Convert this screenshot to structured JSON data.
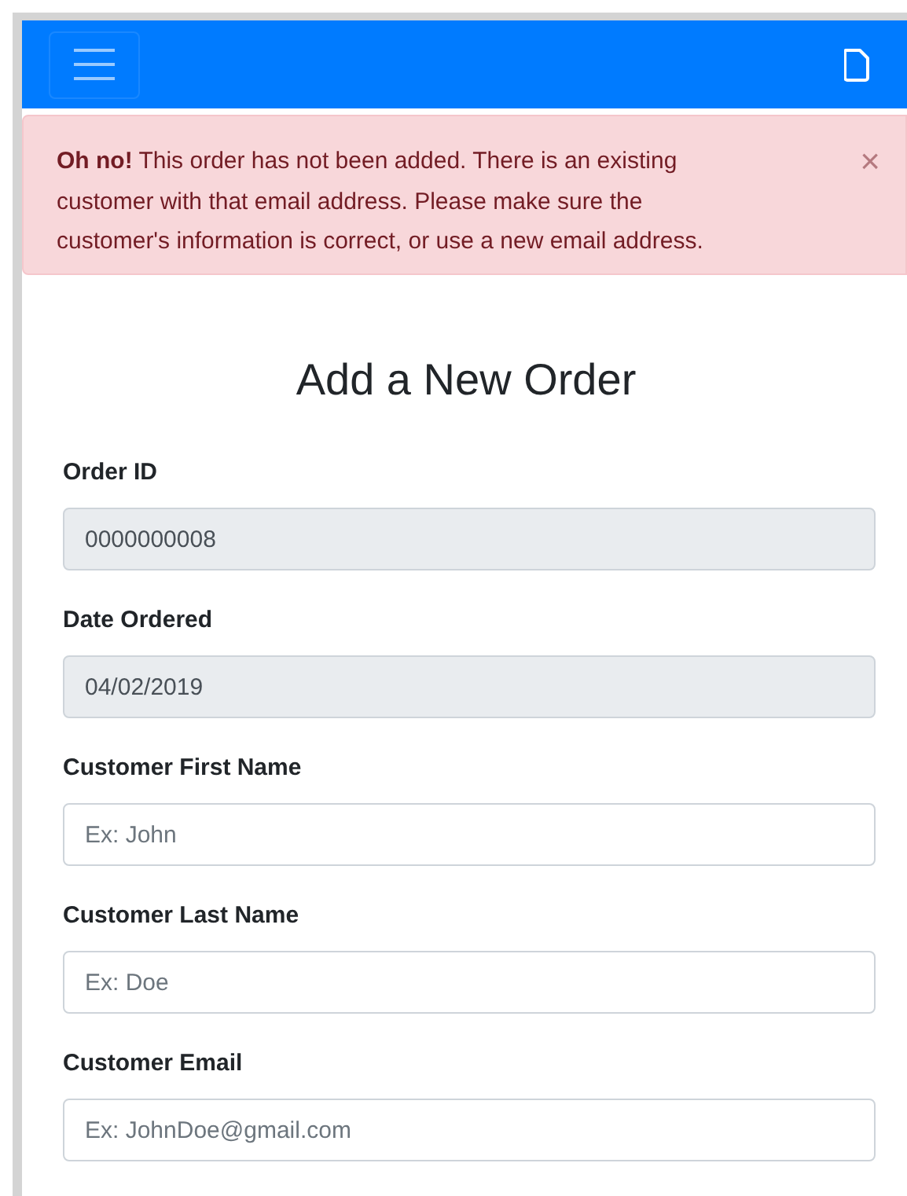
{
  "alert": {
    "message": "**Oh no!** This order has not been added. There is an existing customer with that email address. Please make sure the customer's information is correct, or use a new email address.",
    "close": "×"
  },
  "title": "Add a New Order",
  "fields": [
    {
      "label": "Order ID",
      "value": "0000000008",
      "disabled": true
    },
    {
      "label": "Date Ordered",
      "value": "04/02/2019",
      "disabled": true
    },
    {
      "label": "Customer First Name",
      "placeholder": "Ex: John",
      "disabled": false
    },
    {
      "label": "Customer Last Name",
      "placeholder": "Ex: Doe",
      "disabled": false
    },
    {
      "label": "Customer Email",
      "placeholder": "Ex: JohnDoe@gmail.com",
      "disabled": false
    }
  ]
}
